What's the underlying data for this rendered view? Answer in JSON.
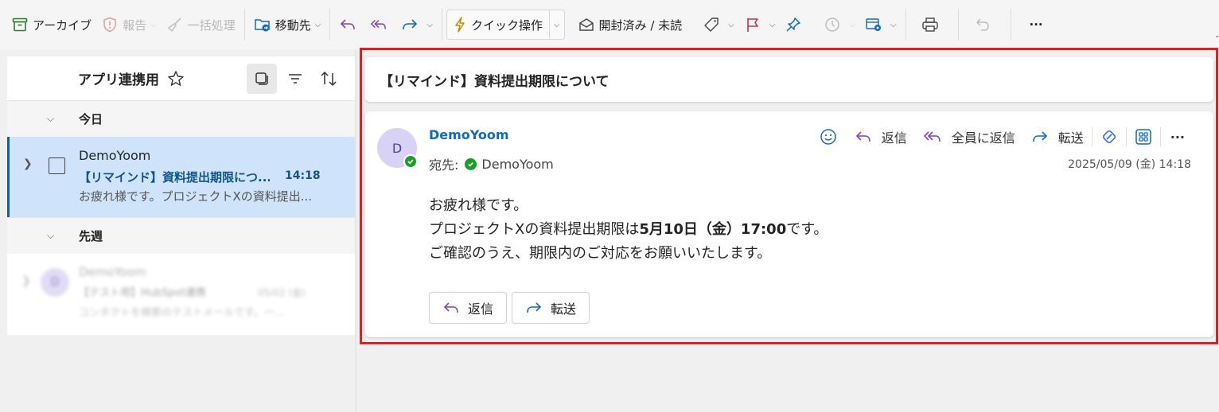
{
  "toolbar": {
    "archive": "アーカイブ",
    "report": "報告",
    "sweep": "一括処理",
    "move_to": "移動先",
    "quick_actions": "クイック操作",
    "read_unread": "開封済み / 未読",
    "more": "···"
  },
  "list": {
    "folder_name": "アプリ連携用",
    "groups": [
      {
        "label": "今日"
      },
      {
        "label": "先週"
      }
    ],
    "selected_message": {
      "sender": "DemoYoom",
      "subject": "【リマインド】資料提出期限につ...",
      "time": "14:18",
      "preview": "お疲れ様です。プロジェクトXの資料提出..."
    },
    "blurred_message": {
      "avatar_initial": "D",
      "sender": "DemoYoom",
      "subject": "【テスト用】HubSpot連携",
      "date": "05/02 (金)",
      "preview": "コンタクトを検索のテストメールです。一..."
    }
  },
  "reading": {
    "subject": "【リマインド】資料提出期限について",
    "avatar_initial": "D",
    "sender": "DemoYoom",
    "to_label": "宛先:",
    "to_name": "DemoYoom",
    "date": "2025/05/09 (金) 14:18",
    "actions": {
      "reply": "返信",
      "reply_all": "全員に返信",
      "forward": "転送",
      "more": "···"
    },
    "body": {
      "line1": "お疲れ様です。",
      "line2_pre": "プロジェクトXの資料提出期限は",
      "line2_bold": "5月10日（金）17:00",
      "line2_post": "です。",
      "line3": "ご確認のうえ、期限内のご対応をお願いいたします。"
    },
    "buttons": {
      "reply": "返信",
      "forward": "転送"
    }
  },
  "colors": {
    "accent": "#0f6cbd",
    "selected_row": "#cfe4fa",
    "highlight_box": "#e02020",
    "flag": "#c4314b",
    "reply_icon": "#8a3fb5",
    "forward_icon": "#0f6cbd"
  }
}
